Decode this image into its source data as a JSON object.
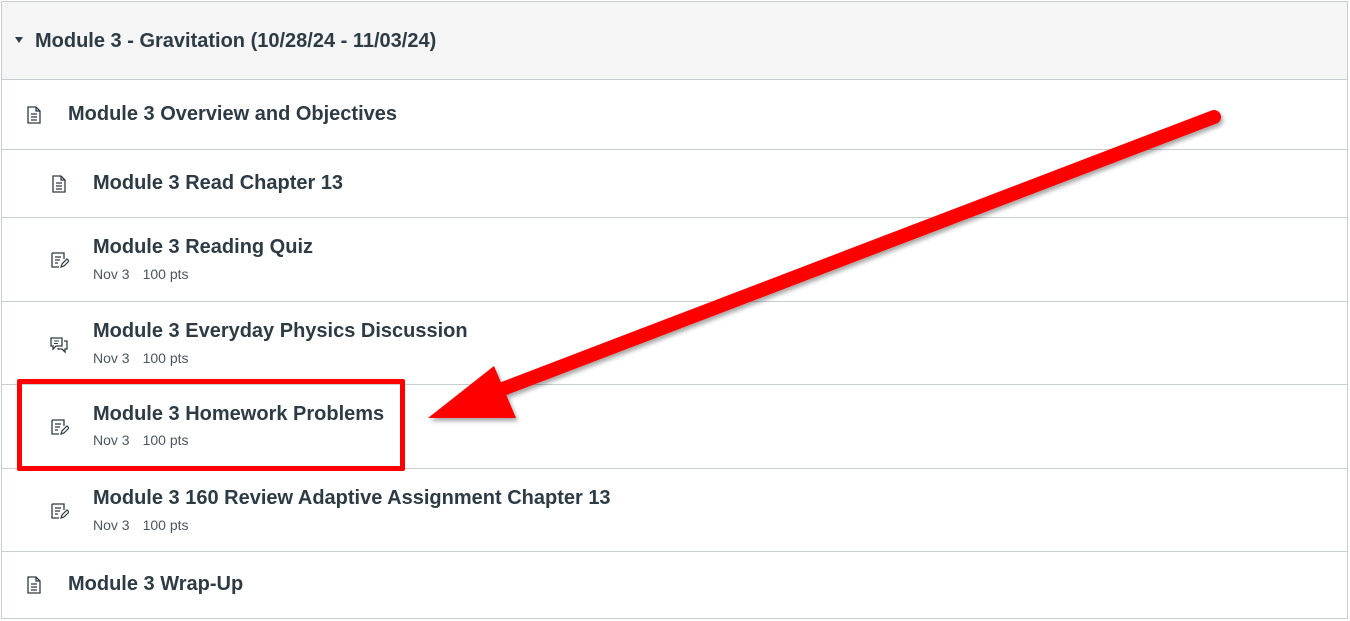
{
  "module": {
    "title": "Module 3 - Gravitation (10/28/24 - 11/03/24)",
    "items": [
      {
        "title": "Module 3 Overview and Objectives",
        "icon": "page-icon"
      },
      {
        "title": "Module 3 Read Chapter 13",
        "icon": "page-icon"
      },
      {
        "title": "Module 3 Reading Quiz",
        "icon": "assignment-icon",
        "due": "Nov 3",
        "points": "100 pts"
      },
      {
        "title": "Module 3 Everyday Physics Discussion",
        "icon": "discussion-icon",
        "due": "Nov 3",
        "points": "100 pts"
      },
      {
        "title": "Module 3 Homework Problems",
        "icon": "assignment-icon",
        "due": "Nov 3",
        "points": "100 pts"
      },
      {
        "title": "Module 3 160 Review Adaptive Assignment Chapter 13",
        "icon": "assignment-icon",
        "due": "Nov 3",
        "points": "100 pts"
      },
      {
        "title": "Module 3 Wrap-Up",
        "icon": "page-icon"
      }
    ]
  },
  "annotation": {
    "color": "#ff0000",
    "target": "Module 3 Homework Problems"
  }
}
